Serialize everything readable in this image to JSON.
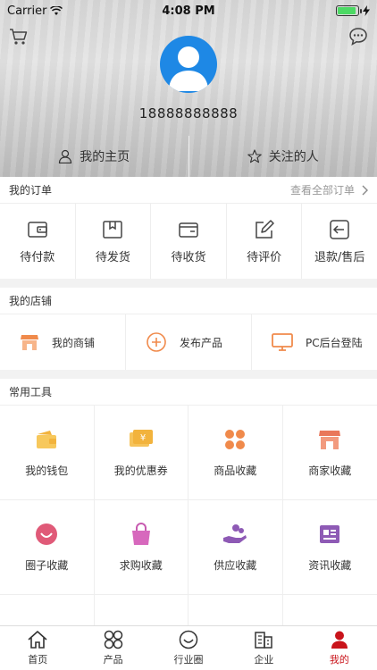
{
  "status_bar": {
    "carrier": "Carrier",
    "time": "4:08 PM",
    "battery_level": 0.9
  },
  "header": {
    "phone": "18888888888",
    "tabs": [
      {
        "label": "我的主页",
        "icon": "user-outline-icon"
      },
      {
        "label": "关注的人",
        "icon": "star-outline-icon"
      }
    ]
  },
  "orders": {
    "title": "我的订单",
    "view_all": "查看全部订单",
    "items": [
      {
        "label": "待付款",
        "icon": "wallet-icon"
      },
      {
        "label": "待发货",
        "icon": "package-icon"
      },
      {
        "label": "待收货",
        "icon": "card-icon"
      },
      {
        "label": "待评价",
        "icon": "edit-icon"
      },
      {
        "label": "退款/售后",
        "icon": "return-icon"
      }
    ]
  },
  "shop": {
    "title": "我的店铺",
    "items": [
      {
        "label": "我的商铺",
        "icon": "storefront-icon"
      },
      {
        "label": "发布产品",
        "icon": "plus-circle-icon"
      },
      {
        "label": "PC后台登陆",
        "icon": "monitor-icon"
      }
    ]
  },
  "tools": {
    "title": "常用工具",
    "items": [
      {
        "label": "我的钱包",
        "icon": "wallet-icon"
      },
      {
        "label": "我的优惠券",
        "icon": "coupon-icon"
      },
      {
        "label": "商品收藏",
        "icon": "clover-icon"
      },
      {
        "label": "商家收藏",
        "icon": "store-icon"
      },
      {
        "label": "圈子收藏",
        "icon": "smile-icon"
      },
      {
        "label": "求购收藏",
        "icon": "shopping-bag-icon"
      },
      {
        "label": "供应收藏",
        "icon": "hand-supply-icon"
      },
      {
        "label": "资讯收藏",
        "icon": "news-icon"
      },
      {
        "label": "",
        "icon": "people-icon"
      },
      {
        "label": "",
        "icon": "dot-icon"
      },
      {
        "label": "",
        "icon": "dot-icon"
      },
      {
        "label": "",
        "icon": "box-icon"
      }
    ]
  },
  "tabbar": {
    "active_color": "#c9141b",
    "items": [
      {
        "label": "首页",
        "icon": "home-icon"
      },
      {
        "label": "产品",
        "icon": "grid-clover-icon"
      },
      {
        "label": "行业圈",
        "icon": "smile-circle-icon"
      },
      {
        "label": "企业",
        "icon": "building-icon"
      },
      {
        "label": "我的",
        "icon": "person-icon",
        "active": true
      }
    ]
  },
  "colors": {
    "accent_red": "#c9141b",
    "avatar_blue": "#1e88e5",
    "orange": "#f08a4b",
    "pink": "#e05a78",
    "purple": "#8e5ab5",
    "yellow": "#f2b33d"
  }
}
